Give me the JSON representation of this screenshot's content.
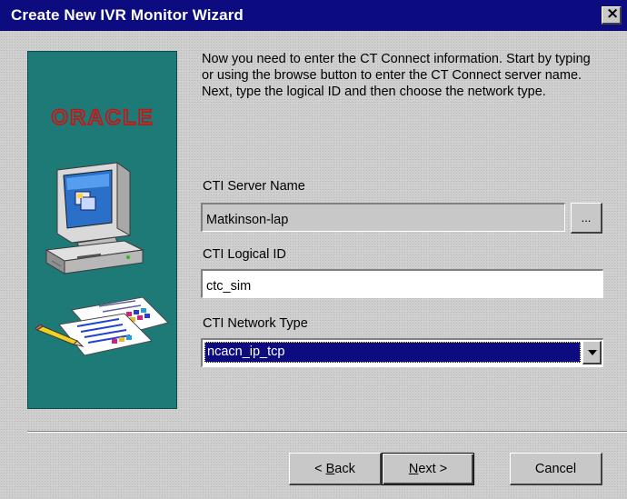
{
  "window": {
    "title": "Create New IVR Monitor Wizard",
    "close_glyph": "×"
  },
  "graphic": {
    "logo_text": "ORACLE",
    "icons": [
      "computer-icon",
      "documents-icon",
      "pencil-icon"
    ]
  },
  "instructions": "Now you need to enter the CT Connect information.  Start by typing or using the browse button to enter the CT Connect server name.  Next, type the logical ID and then choose the network type.",
  "server_name": {
    "label": "CTI Server Name",
    "value": "Matkinson-lap",
    "browse_label": "..."
  },
  "logical_id": {
    "label": "CTI Logical ID",
    "value": "ctc_sim"
  },
  "network_type": {
    "label": "CTI Network Type",
    "selected": "ncacn_ip_tcp"
  },
  "buttons": {
    "back_prefix": "< ",
    "back_accel": "B",
    "back_rest": "ack",
    "next_accel": "N",
    "next_rest": "ext >",
    "cancel": "Cancel"
  },
  "colors": {
    "titlebar": "#0c0c80",
    "panel": "#1e7a76",
    "logo_red": "#d01010",
    "selection": "#0c0c80"
  }
}
